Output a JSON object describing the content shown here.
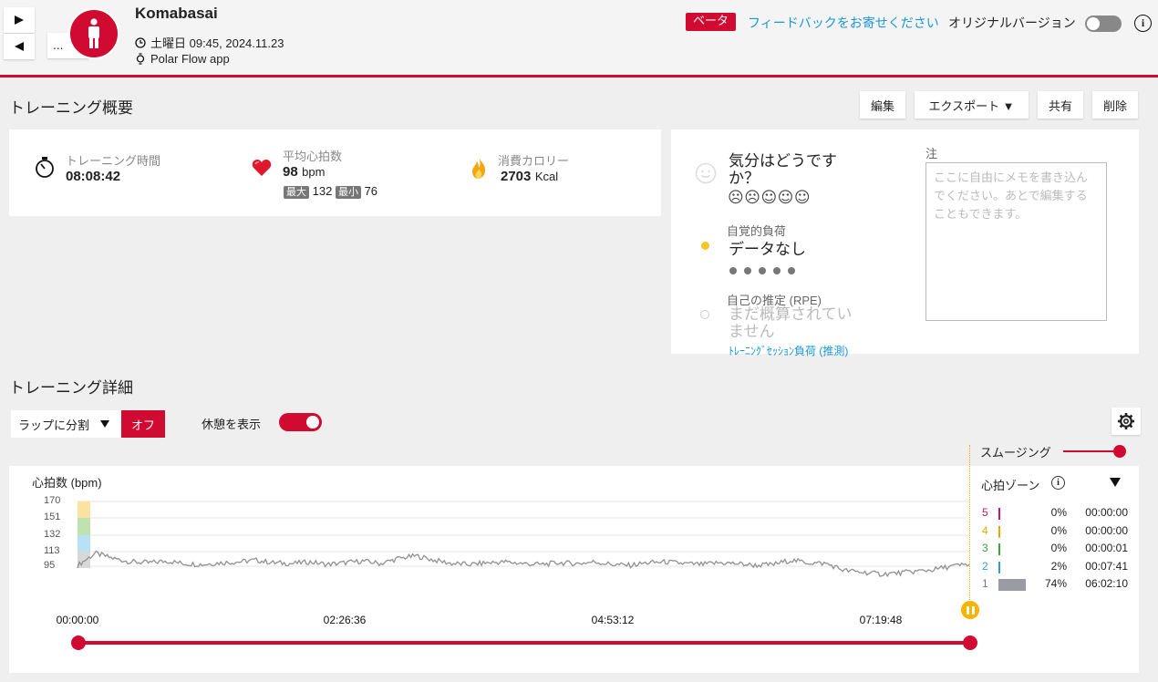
{
  "header": {
    "user_name": "Komabasai",
    "datetime": "土曜日 09:45, 2024.11.23",
    "source": "Polar Flow app",
    "more_label": "...",
    "beta": "ベータ",
    "feedback": "フィードバックをお寄せください",
    "original_version": "オリジナルバージョン",
    "info": "i",
    "original_toggle_on": false
  },
  "summary": {
    "title": "トレーニング概要",
    "buttons": {
      "edit": "編集",
      "export": "エクスポート ▼",
      "share": "共有",
      "delete": "削除"
    },
    "duration_label": "トレーニング時間",
    "duration_value": "08:08:42",
    "hr_label": "平均心拍数",
    "hr_value": "98",
    "hr_unit": "bpm",
    "hr_max_label": "最大",
    "hr_max": "132",
    "hr_min_label": "最小",
    "hr_min": "76",
    "cal_label": "消費カロリー",
    "cal_value": "2703",
    "cal_unit": "Kcal"
  },
  "feel": {
    "question": "気分はどうですか？",
    "faces": "☹☹☺☺☺",
    "rpe_label": "自覚的負荷",
    "rpe_value": "データなし",
    "self_label": "自己の推定 (RPE)",
    "self_value": "まだ概算されていません",
    "load_link": "ﾄﾚｰﾆﾝｸﾞｾｯｼｮﾝ負荷 (推測)",
    "note_label": "注",
    "note_placeholder": "ここに自由にメモを書き込んでください。あとで編集することもできます。"
  },
  "details": {
    "title": "トレーニング詳細",
    "lap_select": "ラップに分割",
    "lap_off": "オフ",
    "rest_label": "休憩を表示",
    "rest_toggle_on": true,
    "smoothing_label": "スムージング"
  },
  "chart_data": {
    "type": "line",
    "ylabel": "心拍数 (bpm)",
    "yticks": [
      "170",
      "151",
      "132",
      "113",
      "95"
    ],
    "ylim": [
      95,
      170
    ],
    "xticks": [
      "00:00:00",
      "02:26:36",
      "04:53:12",
      "07:19:48"
    ],
    "series": [
      {
        "values": [
          96,
          110,
          104,
          100,
          99,
          101,
          98,
          97,
          99,
          100,
          102,
          99,
          98,
          100,
          97,
          99,
          101,
          98,
          104,
          107,
          102,
          98,
          97,
          99,
          100,
          98,
          97,
          99,
          98,
          100,
          97,
          96,
          99,
          100,
          98,
          97,
          99,
          98,
          96,
          97,
          102,
          99,
          98,
          90,
          88,
          86,
          87,
          89,
          91,
          95,
          97
        ]
      }
    ]
  },
  "zones": {
    "title": "心拍ゾーン",
    "rows": [
      {
        "zone": "5",
        "color": "#c8176a",
        "percent": "0%",
        "time": "00:00:00",
        "fill": 0
      },
      {
        "zone": "4",
        "color": "#f0a500",
        "percent": "0%",
        "time": "00:00:00",
        "fill": 0
      },
      {
        "zone": "3",
        "color": "#3aa63a",
        "percent": "0%",
        "time": "00:00:01",
        "fill": 0
      },
      {
        "zone": "2",
        "color": "#2aa0d8",
        "percent": "2%",
        "time": "00:07:41",
        "fill": 0.02
      },
      {
        "zone": "1",
        "color": "#777777",
        "percent": "74%",
        "time": "06:02:10",
        "fill": 0.74
      }
    ]
  },
  "colors": {
    "brand": "#d10a31",
    "link": "#1a97d4",
    "chart_line": "#909090"
  }
}
